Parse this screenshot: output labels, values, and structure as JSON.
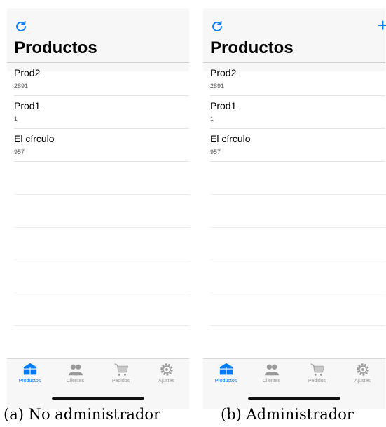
{
  "colors": {
    "accent": "#007aff",
    "inactive": "#9a9a9a"
  },
  "screens": [
    {
      "title": "Productos",
      "show_add": false,
      "products": [
        {
          "name": "Prod2",
          "value": "2891"
        },
        {
          "name": "Prod1",
          "value": "1"
        },
        {
          "name": "El círculo",
          "value": "957"
        }
      ],
      "tabs": [
        {
          "label": "Productos",
          "icon": "products-icon",
          "active": true
        },
        {
          "label": "Clientes",
          "icon": "clients-icon",
          "active": false
        },
        {
          "label": "Pedidos",
          "icon": "cart-icon",
          "active": false
        },
        {
          "label": "Ajustes",
          "icon": "settings-icon",
          "active": false
        }
      ],
      "caption": "(a) No administrador"
    },
    {
      "title": "Productos",
      "show_add": true,
      "add_label": "+",
      "products": [
        {
          "name": "Prod2",
          "value": "2891"
        },
        {
          "name": "Prod1",
          "value": "1"
        },
        {
          "name": "El círculo",
          "value": "957"
        }
      ],
      "tabs": [
        {
          "label": "Productos",
          "icon": "products-icon",
          "active": true
        },
        {
          "label": "Clientes",
          "icon": "clients-icon",
          "active": false
        },
        {
          "label": "Pedidos",
          "icon": "cart-icon",
          "active": false
        },
        {
          "label": "Ajustes",
          "icon": "settings-icon",
          "active": false
        }
      ],
      "caption": "(b) Administrador"
    }
  ]
}
